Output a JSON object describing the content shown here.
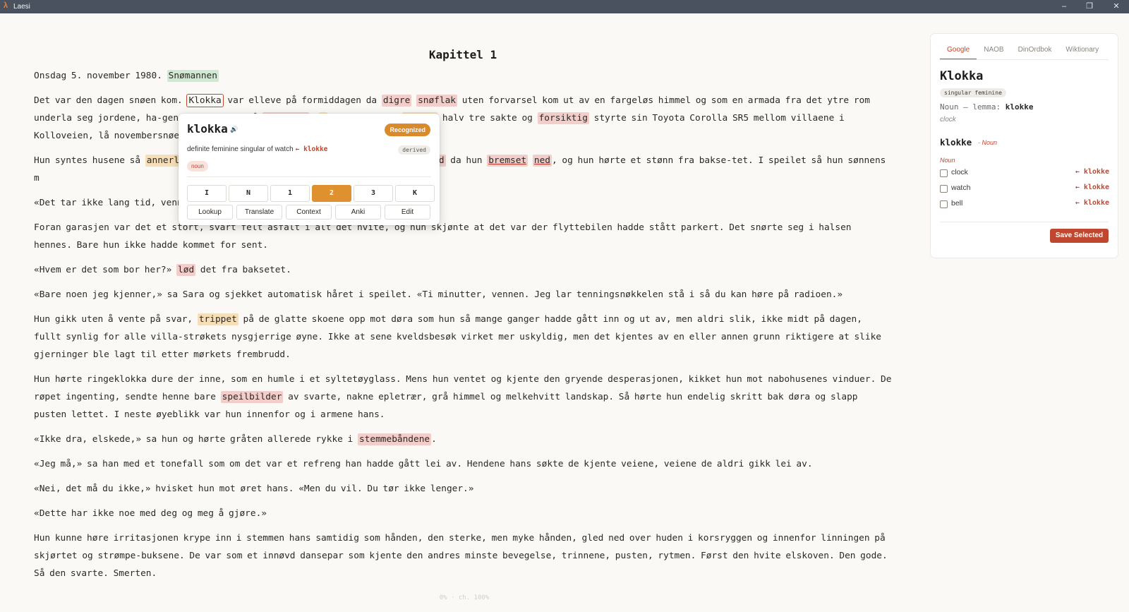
{
  "window": {
    "title": "Laesi",
    "logo": "λ",
    "minimize": "–",
    "maximize": "❐",
    "close": "✕"
  },
  "chapter": {
    "title": "Kapittel 1"
  },
  "paragraphs": [
    [
      {
        "t": "Onsdag 5. november 1980. "
      },
      {
        "t": "Snømannen",
        "hl": "green"
      }
    ],
    [
      {
        "t": "Det var den dagen snøen kom. "
      },
      {
        "t": "Klokka",
        "current": true
      },
      {
        "t": " var elleve på formiddagen da "
      },
      {
        "t": "digre",
        "hl": "red"
      },
      {
        "t": " "
      },
      {
        "t": "snøflak",
        "hl": "red"
      },
      {
        "t": " uten forvarsel kom ut av en fargeløs himmel og som en armada fra det ytre rom underla seg jordene, ha-gene og plenene på "
      },
      {
        "t": "Romerike",
        "hl": "red"
      },
      {
        "t": ". "
      },
      {
        "t": "I",
        "hl": "orange"
      },
      {
        "t": "ra Kvinesland "
      },
      {
        "t": "klokka",
        "hl": "orange"
      },
      {
        "t": " halv tre sakte og "
      },
      {
        "t": "forsiktig",
        "hl": "red"
      },
      {
        "t": " styrte sin Toyota Corolla SR5 mellom villaene i Kolloveien, lå novembersnøen so"
      }
    ],
    [
      {
        "t": "Hun syntes husene så "
      },
      {
        "t": "annerlede",
        "hl": "orange"
      },
      {
        "t": "bi oppkjørselen til garasjen hans. Bilen "
      },
      {
        "t": "skled",
        "hl": "red"
      },
      {
        "t": " da hun "
      },
      {
        "t": "bremset",
        "hl": "red",
        "u": true
      },
      {
        "t": " "
      },
      {
        "t": "ned",
        "hl": "red",
        "u": true
      },
      {
        "t": ", og hun hørte et stønn fra bakse-tet. I speilet så hun sønnens m"
      }
    ],
    [
      {
        "t": "«Det tar ikke lang tid, vennen,»"
      }
    ],
    [
      {
        "t": "Foran garasjen var det et stort, svart felt asfalt i alt det hvite, og hun skjønte at det var der flyttebilen hadde stått parkert. Det snørte seg i halsen hennes. Bare hun ikke hadde kommet for sent."
      }
    ],
    [
      {
        "t": "«Hvem er det som bor her?» "
      },
      {
        "t": "lød",
        "hl": "red"
      },
      {
        "t": " det fra baksetet."
      }
    ],
    [
      {
        "t": "«Bare noen jeg kjenner,» sa Sara og sjekket automatisk håret i speilet. «Ti minutter, vennen. Jeg lar tenningsnøkkelen stå i så du kan høre på radioen.»"
      }
    ],
    [
      {
        "t": "Hun gikk uten å vente på svar, "
      },
      {
        "t": "trippet",
        "hl": "orange"
      },
      {
        "t": " på de glatte skoene opp mot døra som hun så mange ganger hadde gått inn og ut av, men aldri slik, ikke midt på dagen, fullt synlig for alle villa-strøkets nysgjerrige øyne. Ikke at sene kveldsbesøk virket mer uskyldig, men det kjentes av en eller annen grunn riktigere at slike gjerninger ble lagt til etter mørkets frembrudd."
      }
    ],
    [
      {
        "t": "Hun hørte ringeklokka dure der inne, som en humle i et syltetøyglass. Mens hun ventet og kjente den gryende desperasjonen, kikket hun mot nabohusenes vinduer. De røpet ingenting, sendte henne bare "
      },
      {
        "t": "speilbilder",
        "hl": "red"
      },
      {
        "t": " av svarte, nakne epletrær, grå himmel og melkehvitt landskap. Så hørte hun endelig skritt bak døra og slapp pusten lettet. I neste øyeblikk var hun innenfor og i armene hans."
      }
    ],
    [
      {
        "t": "«Ikke dra, elskede,» sa hun og hørte gråten allerede rykke i "
      },
      {
        "t": "stemmebåndene",
        "hl": "red"
      },
      {
        "t": "."
      }
    ],
    [
      {
        "t": "«Jeg må,» sa han med et tonefall som om det var et refreng han hadde gått lei av. Hendene hans søkte de kjente veiene, veiene de aldri gikk lei av."
      }
    ],
    [
      {
        "t": "«Nei, det må du ikke,» hvisket hun mot øret hans. «Men du vil. Du tør ikke lenger.»"
      }
    ],
    [
      {
        "t": "«Dette har ikke noe med deg og meg å gjøre.»"
      }
    ],
    [
      {
        "t": "Hun kunne høre irritasjonen krype inn i stemmen hans samtidig som hånden, den sterke, men myke hånden, gled ned over huden i korsryggen og innenfor linningen på skjørtet og strømpe-buksene. De var som et innøvd dansepar som kjente den andres minste bevegelse, trinnene, pusten, rytmen. Først den hvite elskoven. Den gode. Så den svarte. Smerten."
      }
    ]
  ],
  "popup": {
    "word": "klokka",
    "speaker_icon": "🔊",
    "status": "Recognized",
    "gloss": "definite feminine singular of watch",
    "gloss_lemma": "← klokke",
    "derived": "derived",
    "pos": "noun",
    "levels": [
      "I",
      "N",
      "1",
      "2",
      "3",
      "K"
    ],
    "active_level": "2",
    "actions": [
      "Lookup",
      "Translate",
      "Context",
      "Anki",
      "Edit"
    ]
  },
  "dictionary": {
    "tabs": [
      "Google",
      "NAOB",
      "DinOrdbok",
      "Wiktionary"
    ],
    "active_tab": "Google",
    "headword": "Klokka",
    "tag": "singular feminine",
    "lemma_prefix": "Noun — lemma: ",
    "lemma": "klokke",
    "sense": "clock",
    "entry_word": "klokke",
    "entry_pos_inline": "· Noun",
    "entry_pos": "Noun",
    "translations": [
      {
        "label": "clock",
        "lemma": "← klokke"
      },
      {
        "label": "watch",
        "lemma": "← klokke"
      },
      {
        "label": "bell",
        "lemma": "← klokke"
      }
    ],
    "save_label": "Save Selected"
  },
  "footer": {
    "progress": "0% · ch. 100%"
  }
}
